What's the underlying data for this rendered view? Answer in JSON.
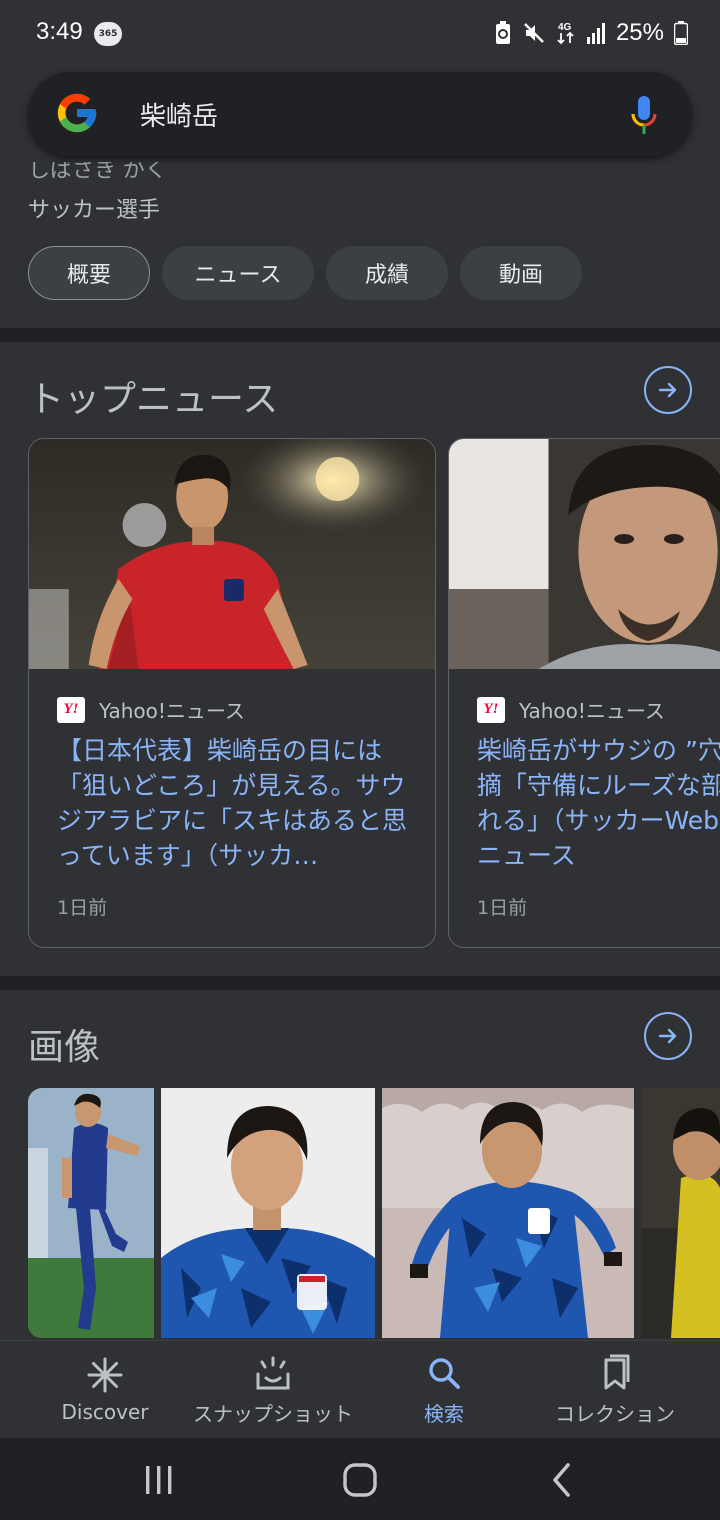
{
  "status": {
    "time": "3:49",
    "app_badge": "365",
    "battery": "25%"
  },
  "search": {
    "query": "柴崎岳"
  },
  "entity": {
    "reading_partial": "しばさき がく",
    "description": "サッカー選手"
  },
  "chips": [
    {
      "label": "概要"
    },
    {
      "label": "ニュース"
    },
    {
      "label": "成績"
    },
    {
      "label": "動画"
    }
  ],
  "top_news": {
    "title": "トップニュース",
    "articles": [
      {
        "source": "Yahoo!ニュース",
        "headline": "【日本代表】柴崎岳の目には「狙いどころ」が見える。サウジアラビアに「スキはあると思っています」（サッカ…",
        "time": "1日前"
      },
      {
        "source": "Yahoo!ニュース",
        "headline": "柴崎岳がサウジの ”穴” をズバリ指摘「守備にルーズな部分も見受けられる」（サッカーWeb） - Yahoo!ニュース",
        "time": "1日前"
      }
    ]
  },
  "images": {
    "title": "画像"
  },
  "bottom_nav": [
    {
      "label": "Discover",
      "icon": "discover-icon"
    },
    {
      "label": "スナップショット",
      "icon": "snapshot-icon"
    },
    {
      "label": "検索",
      "icon": "search-icon"
    },
    {
      "label": "コレクション",
      "icon": "collections-icon"
    }
  ],
  "colors": {
    "accent": "#8ab4f8",
    "surface": "#303134",
    "background": "#202124"
  }
}
